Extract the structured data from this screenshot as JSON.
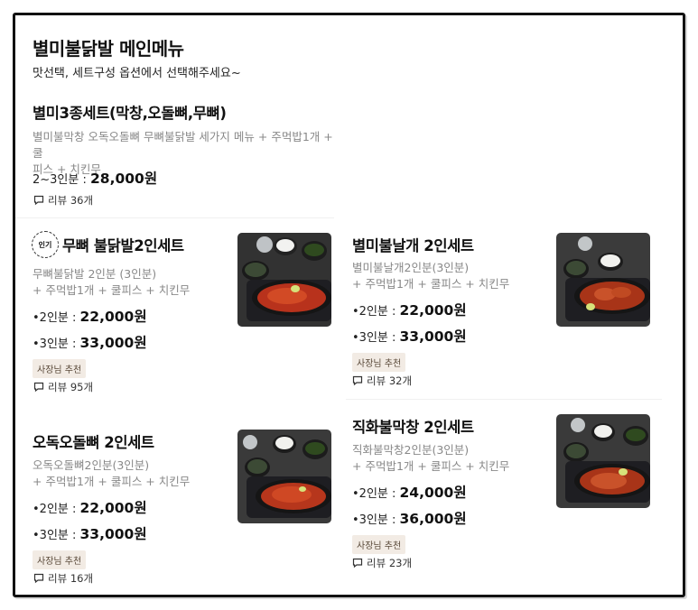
{
  "header": {
    "title": "별미불닭발 메인메뉴",
    "subtitle": "맛선택, 세트구성 옵션에서 선택해주세요~"
  },
  "items": [
    {
      "name": "별미3종세트(막창,오돌뼈,무뼈)",
      "desc_1": "별미불막창 오독오돌뼈 무뼈불닭발 세가지 메뉴 + 주먹밥1개 +  쿨",
      "desc_2": "피스 + 치킨무",
      "price_1_label": "2~3인분 : ",
      "price_1": "28,000원",
      "review": "리뷰 36개"
    },
    {
      "popular_badge": "인기",
      "name": "무뼈 불닭발2인세트",
      "desc_1": "무뼈불닭발 2인분 (3인분)",
      "desc_2": "+ 주먹밥1개 +  쿨피스 + 치킨무",
      "price_1_label": "2인분 : ",
      "price_1": "22,000원",
      "price_2_label": "3인분 : ",
      "price_2": "33,000원",
      "badge": "사장님 추천",
      "review": "리뷰 95개"
    },
    {
      "name": "별미불날개 2인세트",
      "desc_1": "별미불날개2인분(3인분)",
      "desc_2": "+ 주먹밥1개 +  쿨피스 + 치킨무",
      "price_1_label": "2인분 : ",
      "price_1": "22,000원",
      "price_2_label": "3인분 : ",
      "price_2": "33,000원",
      "badge": "사장님 추천",
      "review": "리뷰 32개"
    },
    {
      "name": "오독오돌뼈 2인세트",
      "desc_1": "오독오돌뼈2인분(3인분)",
      "desc_2": "+ 주먹밥1개 +  쿨피스 + 치킨무",
      "price_1_label": "2인분 : ",
      "price_1": "22,000원",
      "price_2_label": "3인분 : ",
      "price_2": "33,000원",
      "badge": "사장님 추천",
      "review": "리뷰 16개"
    },
    {
      "name": "직화불막창 2인세트",
      "desc_1": "직화불막창2인분(3인분)",
      "desc_2": "+ 주먹밥1개 +  쿨피스 + 치킨무",
      "price_1_label": "2인분 : ",
      "price_1": "24,000원",
      "price_2_label": "3인분 : ",
      "price_2": "36,000원",
      "badge": "사장님 추천",
      "review": "리뷰 23개"
    }
  ],
  "bullet": "•",
  "icons": {
    "review": "speech-bubble-icon",
    "popular": "popular-stamp-icon"
  }
}
